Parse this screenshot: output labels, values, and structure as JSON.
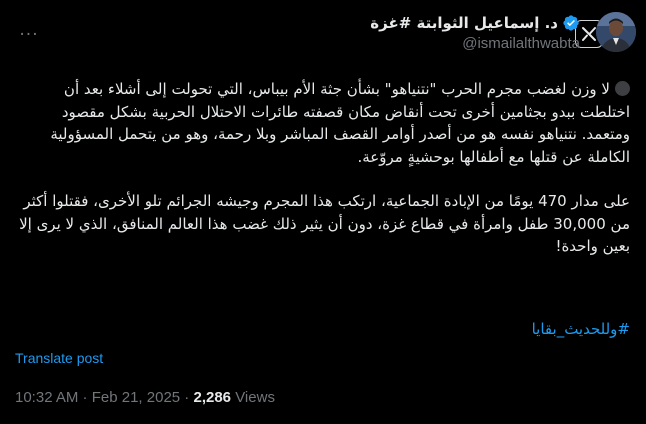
{
  "header": {
    "menu_label": "···",
    "display_name": "د. إسماعيل الثوابتة #غزة",
    "handle": "@ismailalthwabta"
  },
  "tweet": {
    "paragraph_1": "لا وزن لغضب مجرم الحرب \"نتنياهو\" بشأن جثة الأم بيباس، التي تحولت إلى أشلاء بعد أن اختلطت ببدو بجثامين أخرى تحت أنقاض مكان قصفته طائرات الاحتلال الحربية بشكل مقصود ومتعمد. نتنياهو نفسه هو من أصدر أوامر القصف المباشر وبلا رحمة، وهو من يتحمل المسؤولية الكاملة عن قتلها مع أطفالها بوحشيةٍ مروّعة.",
    "paragraph_2": "على مدار 470 يومًا من الإبادة الجماعية، ارتكب هذا المجرم وجيشه الجرائم تلو الأخرى، فقتلوا أكثر من 30,000 طفل وامرأة في قطاع غزة، دون أن يثير ذلك غضب هذا العالم المنافق، الذي لا يرى إلا بعين واحدة!",
    "hashtag": "#وللحديث_بقايا"
  },
  "translate_label": "Translate post",
  "meta": {
    "time": "10:32 AM",
    "separator": " · ",
    "date": "Feb 21, 2025",
    "views_count": "2,286",
    "views_label": " Views"
  },
  "colors": {
    "background": "#000000",
    "text": "#e7e9ea",
    "muted": "#71767b",
    "link": "#1d9bf0",
    "verified": "#1d9bf0"
  },
  "icons": {
    "menu": "more-horizontal-icon",
    "logo": "x-grok-logo-icon",
    "verified": "verified-badge-icon",
    "status_dot": "circle-emoji-icon"
  }
}
